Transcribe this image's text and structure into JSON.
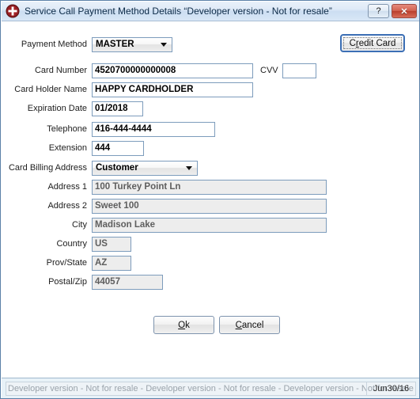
{
  "window": {
    "title": "Service Call Payment Method Details “Developer version - Not for resale”",
    "icon": "first-aid-cross-icon",
    "help_button": "?",
    "close_button": "✕",
    "accent_border": "#5b81a8",
    "titlebar_text_color": "#0c2a47",
    "close_button_color": "#b83d2c"
  },
  "form": {
    "payment_method": {
      "label": "Payment Method",
      "value": "MASTER",
      "type": "combobox"
    },
    "card_number": {
      "label": "Card Number",
      "value": "4520700000000008",
      "type": "text"
    },
    "cvv": {
      "label": "CVV",
      "value": "",
      "type": "text"
    },
    "card_holder_name": {
      "label": "Card Holder Name",
      "value": "HAPPY CARDHOLDER",
      "type": "text"
    },
    "expiration_date": {
      "label": "Expiration Date",
      "value": "01/2018",
      "type": "text"
    },
    "telephone": {
      "label": "Telephone",
      "value": "416-444-4444",
      "type": "text"
    },
    "extension": {
      "label": "Extension",
      "value": "444",
      "type": "text"
    },
    "card_billing_address": {
      "label": "Card Billing Address",
      "value": "Customer",
      "type": "combobox"
    },
    "address_1": {
      "label": "Address 1",
      "value": "100 Turkey Point Ln",
      "type": "text",
      "readonly": true
    },
    "address_2": {
      "label": "Address 2",
      "value": "Sweet 100",
      "type": "text",
      "readonly": true
    },
    "city": {
      "label": "City",
      "value": "Madison Lake",
      "type": "text",
      "readonly": true
    },
    "country": {
      "label": "Country",
      "value": "US",
      "type": "text",
      "readonly": true
    },
    "prov_state": {
      "label": "Prov/State",
      "value": "AZ",
      "type": "text",
      "readonly": true
    },
    "postal_zip": {
      "label": "Postal/Zip",
      "value": "44057",
      "type": "text",
      "readonly": true
    }
  },
  "buttons": {
    "credit_card": {
      "label_pre": "C",
      "label_accel": "r",
      "label_post": "edit Card",
      "full": "Credit Card",
      "focused": true
    },
    "ok": {
      "label_accel": "O",
      "label_post": "k",
      "full": "Ok"
    },
    "cancel": {
      "label_accel": "C",
      "label_post": "ancel",
      "full": "Cancel"
    }
  },
  "statusbar": {
    "marquee": "Developer version - Not for resale - Developer version - Not for resale - Developer version - Not for resale - Deve",
    "date": "Jun30/16"
  }
}
